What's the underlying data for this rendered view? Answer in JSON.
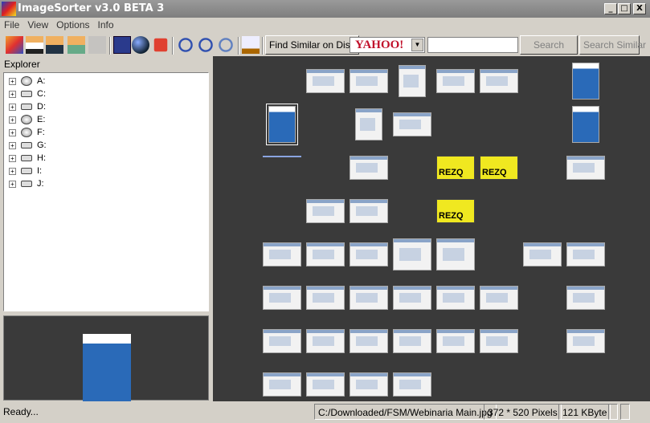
{
  "window": {
    "title": "ImageSorter v3.0 BETA 3",
    "minimize": "_",
    "maximize": "□",
    "close": "X"
  },
  "menu": [
    "File",
    "View",
    "Options",
    "Info"
  ],
  "toolbar": {
    "icons": [
      "sort-by-color-icon",
      "sort-by-name-icon",
      "sort-by-size-icon",
      "sort-by-date-icon",
      "sort-disabled-icon",
      "view-square-icon",
      "view-sphere-icon",
      "stop-icon",
      "zoom-in-icon",
      "zoom-out-icon",
      "zoom-fit-icon",
      "paint-bucket-icon"
    ],
    "find_similar_label": "Find Similar on Disk",
    "search_engine": "YAHOO!",
    "search_value": "",
    "search_label": "Search",
    "search_similar_label": "Search Similar"
  },
  "explorer": {
    "label": "Explorer",
    "drives": [
      "A:",
      "C:",
      "D:",
      "E:",
      "F:",
      "G:",
      "H:",
      "I:",
      "J:"
    ]
  },
  "thumbnails": [
    "screen",
    "screen",
    "screen",
    "screen",
    "screen",
    "blue",
    "blue",
    "screen",
    "screen",
    "blue",
    "line",
    "screen",
    "rezq",
    "rezq",
    "screen",
    "screen",
    "screen",
    "rezq",
    "screen",
    "screen",
    "screen",
    "screen",
    "screen",
    "screen",
    "screen",
    "screen",
    "screen",
    "screen",
    "screen",
    "screen",
    "screen",
    "screen",
    "screen",
    "screen",
    "screen",
    "screen",
    "screen",
    "screen",
    "screen",
    "screen",
    "screen",
    "screen",
    "screen"
  ],
  "status": {
    "text": "Ready...",
    "path": "C:/Downloaded/FSM/Webinaria Main.jpg",
    "dimensions": "372 * 520 Pixels",
    "size": "121 KByte"
  }
}
